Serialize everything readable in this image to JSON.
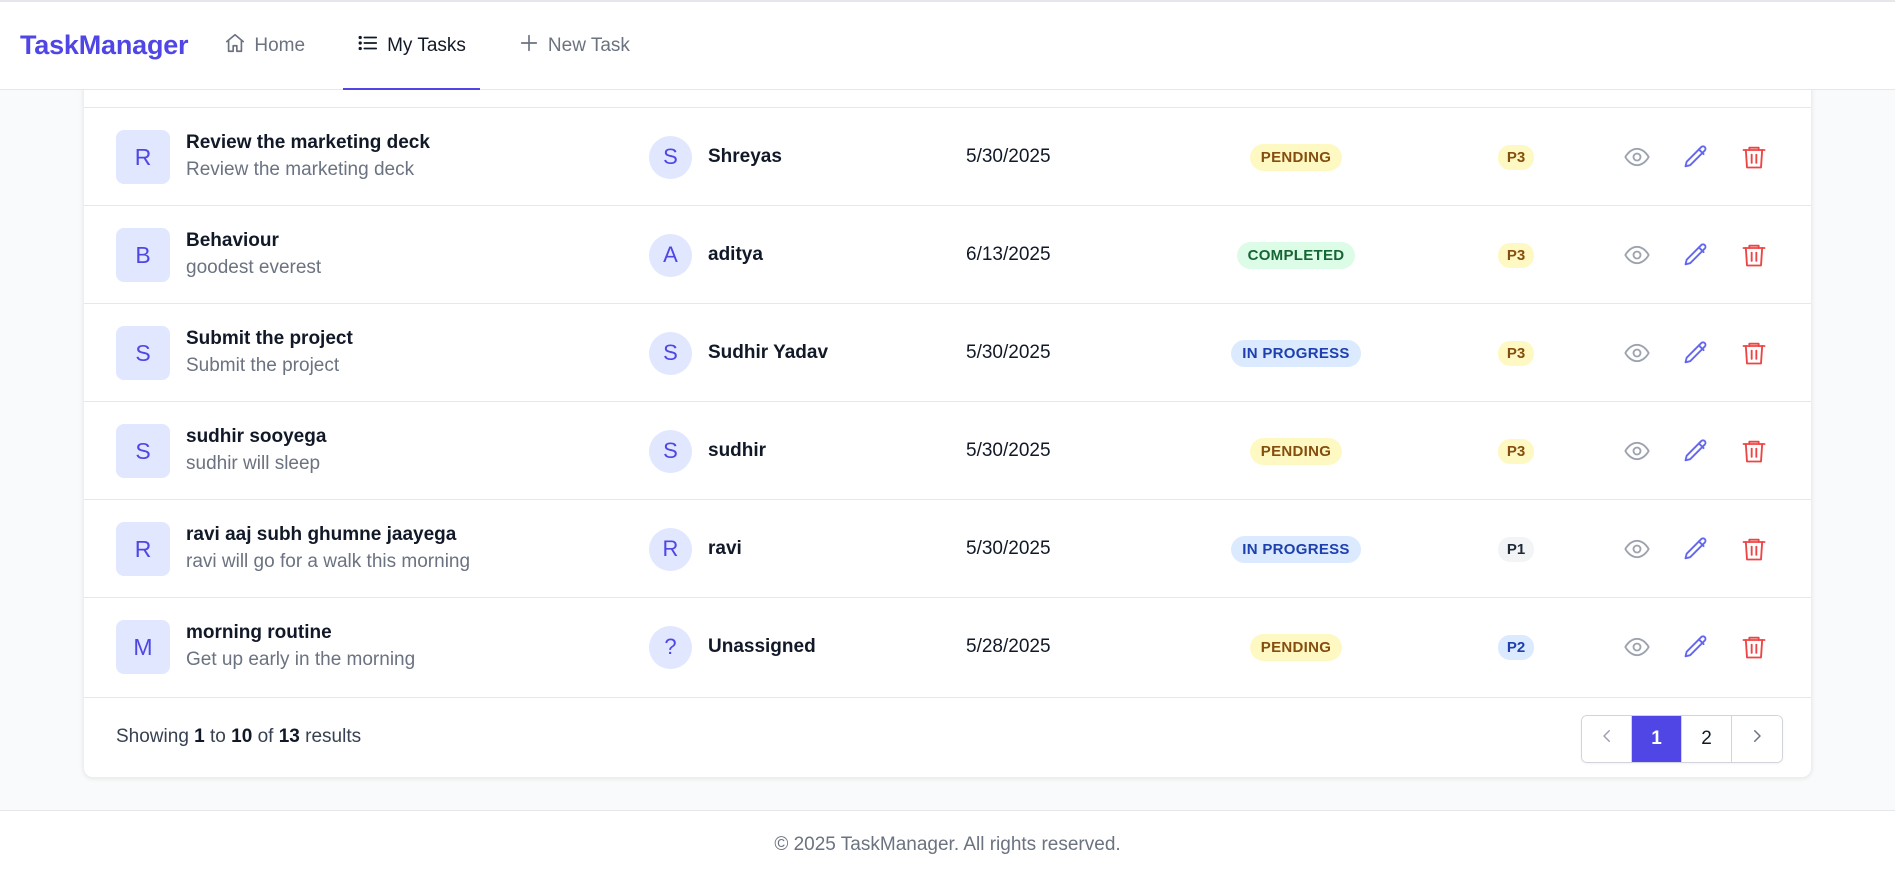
{
  "app": {
    "brand": "TaskManager"
  },
  "nav": [
    {
      "label": "Home",
      "icon": "home-icon",
      "active": false
    },
    {
      "label": "My Tasks",
      "icon": "list-icon",
      "active": true
    },
    {
      "label": "New Task",
      "icon": "plus-icon",
      "active": false
    }
  ],
  "tasks": [
    {
      "initial": "R",
      "title": "Review the marketing deck",
      "description": "Review the marketing deck",
      "assignee_initial": "S",
      "assignee": "Shreyas",
      "due": "5/30/2025",
      "status": "PENDING",
      "priority": "P3"
    },
    {
      "initial": "B",
      "title": "Behaviour",
      "description": "goodest everest",
      "assignee_initial": "A",
      "assignee": "aditya",
      "due": "6/13/2025",
      "status": "COMPLETED",
      "priority": "P3"
    },
    {
      "initial": "S",
      "title": "Submit the project",
      "description": "Submit the project",
      "assignee_initial": "S",
      "assignee": "Sudhir Yadav",
      "due": "5/30/2025",
      "status": "IN PROGRESS",
      "priority": "P3"
    },
    {
      "initial": "S",
      "title": "sudhir sooyega",
      "description": "sudhir will sleep",
      "assignee_initial": "S",
      "assignee": "sudhir",
      "due": "5/30/2025",
      "status": "PENDING",
      "priority": "P3"
    },
    {
      "initial": "R",
      "title": "ravi aaj subh ghumne jaayega",
      "description": "ravi will go for a walk this morning",
      "assignee_initial": "R",
      "assignee": "ravi",
      "due": "5/30/2025",
      "status": "IN PROGRESS",
      "priority": "P1"
    },
    {
      "initial": "M",
      "title": "morning routine",
      "description": "Get up early in the morning",
      "assignee_initial": "?",
      "assignee": "Unassigned",
      "due": "5/28/2025",
      "status": "PENDING",
      "priority": "P2"
    }
  ],
  "pagination": {
    "showing_prefix": "Showing",
    "from": "1",
    "to_word": "to",
    "to": "10",
    "of_word": "of",
    "total": "13",
    "suffix": "results",
    "pages": [
      "1",
      "2"
    ],
    "current_page": "1"
  },
  "footer": {
    "text": "© 2025 TaskManager. All rights reserved."
  },
  "colors": {
    "accent": "#4f46e5",
    "danger": "#ef4444",
    "muted": "#9ca3af"
  },
  "icons": {
    "view": "eye-icon",
    "edit": "pencil-icon",
    "delete": "trash-icon",
    "prev": "chevron-left-icon",
    "next": "chevron-right-icon"
  }
}
